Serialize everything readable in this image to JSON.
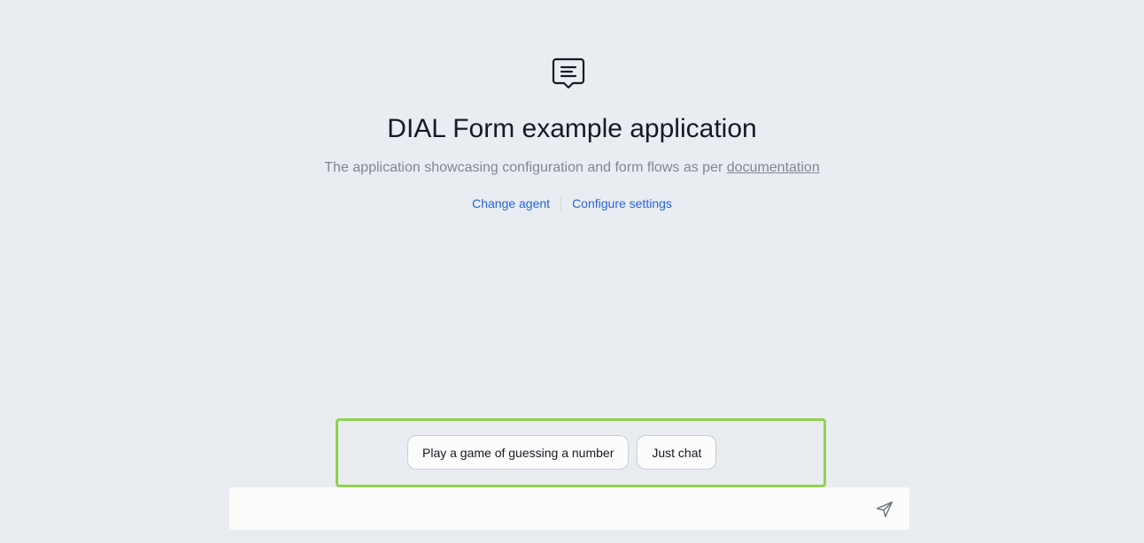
{
  "header": {
    "icon": "chat-message-icon",
    "title": "DIAL Form example application",
    "subtitle_text": "The application showcasing configuration and form flows as per",
    "subtitle_link": "documentation"
  },
  "actions": {
    "change_agent": "Change agent",
    "configure_settings": "Configure settings"
  },
  "suggestions": [
    {
      "label": "Play a game of guessing a number"
    },
    {
      "label": "Just chat"
    }
  ],
  "composer": {
    "placeholder": "",
    "send_icon": "send-icon"
  },
  "colors": {
    "background": "#e9edf1",
    "link": "#2764d9",
    "highlight": "#8fd14f"
  }
}
